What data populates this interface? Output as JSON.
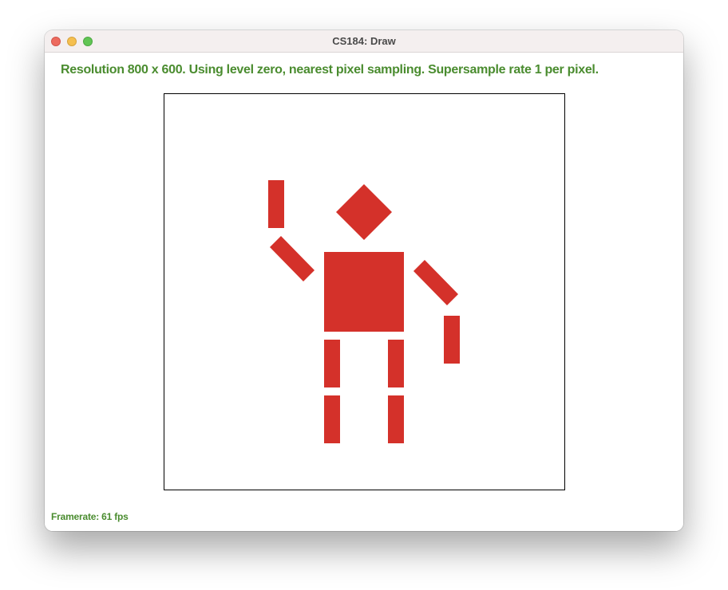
{
  "window": {
    "title": "CS184: Draw"
  },
  "status": {
    "resolution_text": "Resolution 800 x 600. Using level zero, nearest pixel sampling. Supersample rate 1 per pixel.",
    "framerate_text": "Framerate: 61 fps"
  },
  "colors": {
    "status_text": "#4a8c2f",
    "figure_fill": "#d4312a",
    "canvas_border": "#000000"
  },
  "canvas": {
    "content": "stick-figure",
    "shapes": [
      "head",
      "torso",
      "left-upper-arm",
      "left-forearm",
      "right-upper-arm",
      "right-forearm",
      "left-thigh",
      "left-shin",
      "right-thigh",
      "right-shin"
    ]
  }
}
